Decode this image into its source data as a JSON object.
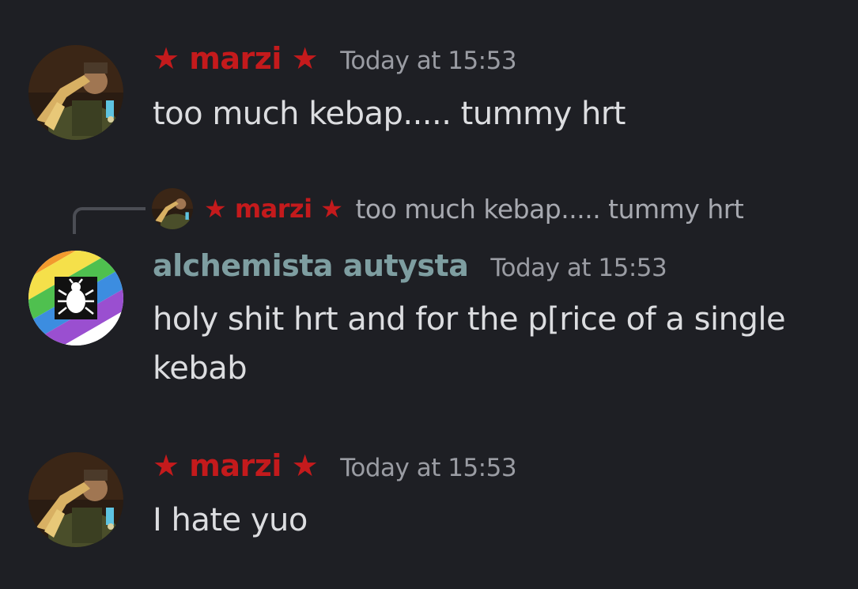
{
  "colors": {
    "background": "#1e1f24",
    "marzi_name": "#c41a1c",
    "alchemista_name": "#7e9ea1",
    "message_text": "#dcdde0",
    "timestamp": "#9a9ca3"
  },
  "messages": [
    {
      "author": "★ marzi ★",
      "timestamp": "Today at 15:53",
      "text": "too much kebap..... tummy hrt",
      "avatar_icon": "saluting-man-avatar"
    },
    {
      "reply": {
        "author": "★ marzi ★",
        "text": "too much kebap..... tummy hrt"
      },
      "author": "alchemista autysta",
      "timestamp": "Today at 15:53",
      "text": "holy shit hrt and for the p[rice of a single kebab",
      "avatar_icon": "rainbow-bug-avatar"
    },
    {
      "author": "★ marzi ★",
      "timestamp": "Today at 15:53",
      "text": "I hate yuo",
      "avatar_icon": "saluting-man-avatar"
    }
  ]
}
